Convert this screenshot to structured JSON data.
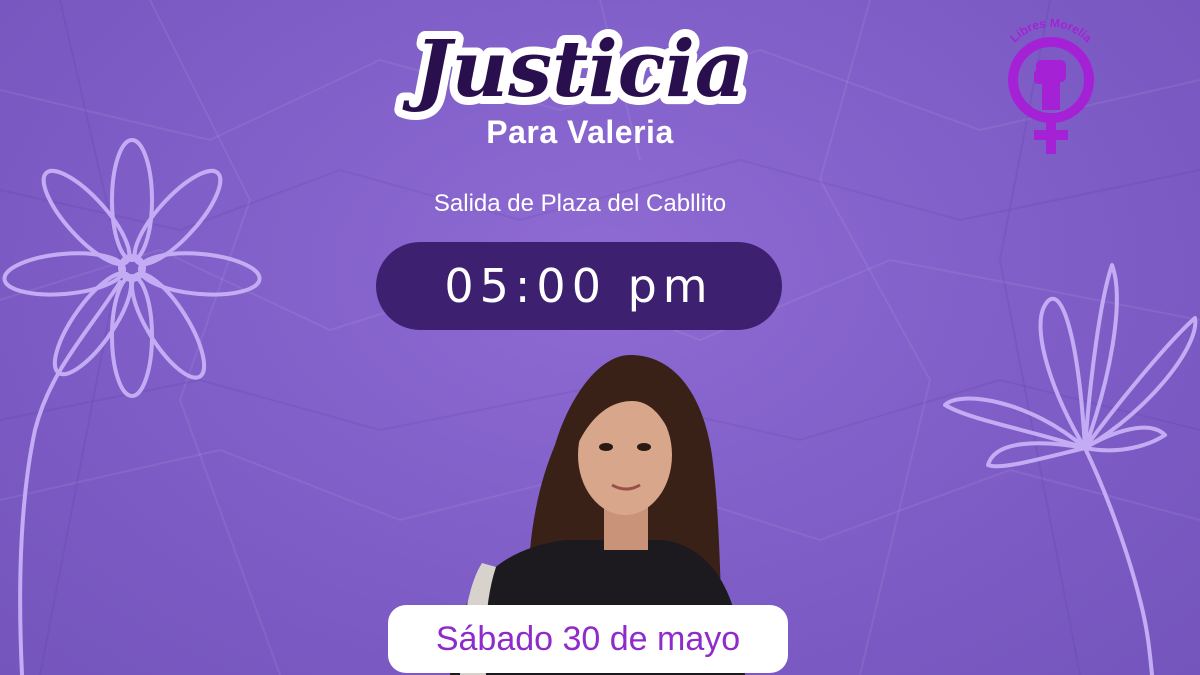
{
  "poster": {
    "title": "Justicia",
    "subtitle": "Para Valeria",
    "location": "Salida de Plaza del Cabllito",
    "time": "05:00 pm",
    "date": "Sábado 30 de mayo"
  },
  "logo": {
    "text": "Libres Morelia",
    "icon": "feminist-fist-venus-symbol"
  },
  "colors": {
    "background": "#8160c9",
    "flower_outline": "#c4acf4",
    "time_pill": "#3d2170",
    "date_text": "#8e2bc9",
    "logo": "#a521d6"
  }
}
